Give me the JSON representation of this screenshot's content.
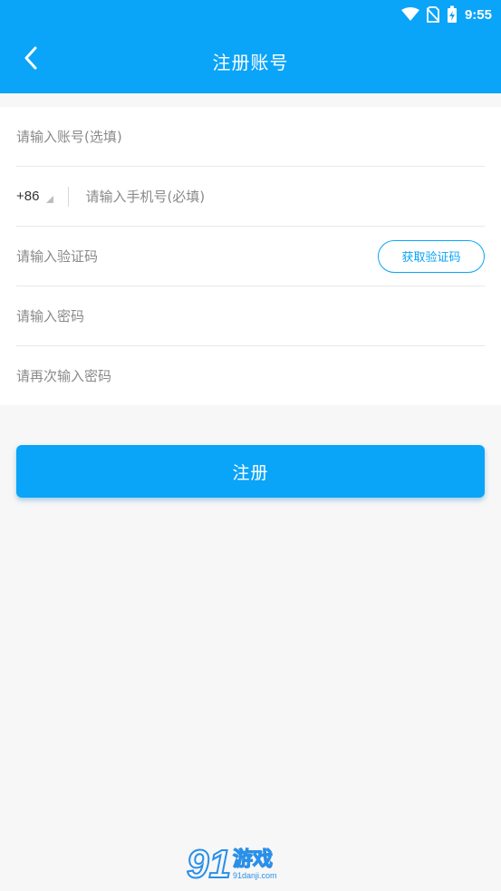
{
  "status_bar": {
    "time": "9:55",
    "icons": [
      "wifi-icon",
      "no-sim-icon",
      "battery-charging-icon"
    ]
  },
  "header": {
    "title": "注册账号",
    "back_icon": "chevron-left-icon"
  },
  "form": {
    "account": {
      "placeholder": "请输入账号(选填)",
      "value": ""
    },
    "phone": {
      "country_code": "+86",
      "placeholder": "请输入手机号(必填)",
      "value": ""
    },
    "verification": {
      "placeholder": "请输入验证码",
      "value": "",
      "button_label": "获取验证码"
    },
    "password": {
      "placeholder": "请输入密码",
      "value": ""
    },
    "confirm_password": {
      "placeholder": "请再次输入密码",
      "value": ""
    }
  },
  "register_button": {
    "label": "注册"
  },
  "watermark": {
    "number": "91",
    "text": "游戏",
    "sub": "91danji.com"
  },
  "colors": {
    "primary": "#0aa4f8",
    "background": "#f7f7f7",
    "placeholder": "#8a8a8a"
  }
}
